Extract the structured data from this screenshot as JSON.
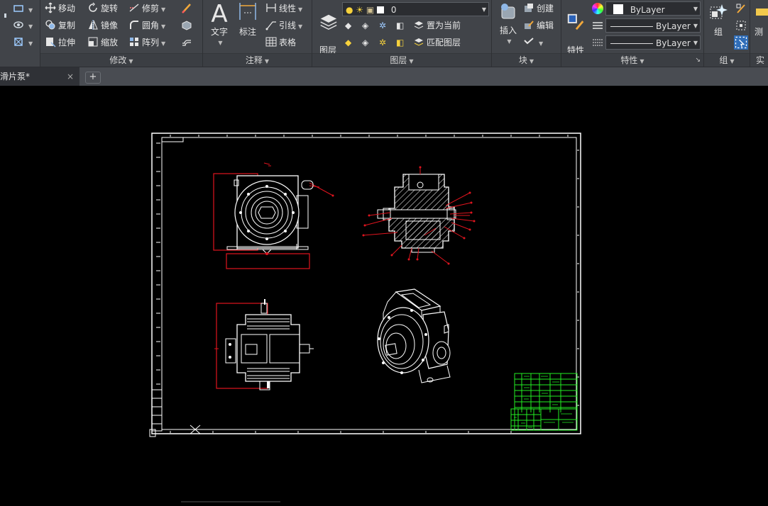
{
  "ribbon": {
    "modify": {
      "title": "修改",
      "move": "移动",
      "rotate": "旋转",
      "trim": "修剪",
      "copy": "复制",
      "mirror": "镜像",
      "fillet": "圆角",
      "stretch": "拉伸",
      "scale": "缩放",
      "array": "阵列"
    },
    "annotation": {
      "title": "注释",
      "text": "文字",
      "dimension": "标注",
      "linear": "线性",
      "leader": "引线",
      "table": "表格"
    },
    "layers": {
      "title": "图层",
      "layer_properties": "图层\n特性",
      "current_layer": "0",
      "set_current": "置为当前",
      "match_layer": "匹配图层"
    },
    "block": {
      "title": "块",
      "insert": "插入",
      "create": "创建",
      "edit": "编辑"
    },
    "properties": {
      "title": "特性",
      "match_properties": "特性\n匹配",
      "color": "ByLayer",
      "linetype": "ByLayer",
      "lineweight": "ByLayer"
    },
    "groups": {
      "title": "组",
      "group": "组"
    },
    "utilities": {
      "title": "实用",
      "measure": "测"
    }
  },
  "tabs": {
    "document": "滑片泵*",
    "close": "×",
    "add": "+"
  },
  "colors": {
    "ribbon_bg": "#414449",
    "canvas_bg": "#000000",
    "frame": "#ffffff",
    "dimension_red": "#e0141e",
    "titleblock_green": "#22ee22"
  }
}
